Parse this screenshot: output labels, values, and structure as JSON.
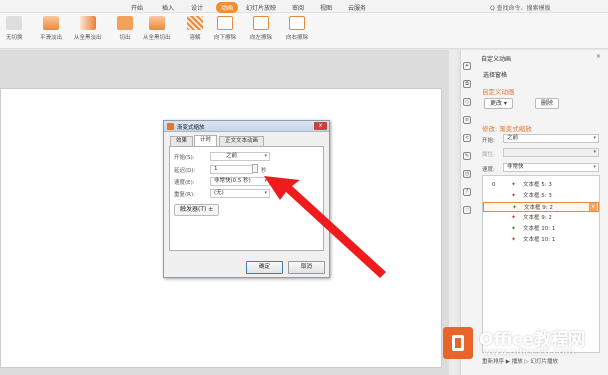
{
  "menubar": {
    "items": [
      {
        "label": "开始",
        "active": false
      },
      {
        "label": "插入",
        "active": false
      },
      {
        "label": "设计",
        "active": false
      },
      {
        "label": "动画",
        "active": true
      },
      {
        "label": "幻灯片放映",
        "active": false
      },
      {
        "label": "审阅",
        "active": false
      },
      {
        "label": "视图",
        "active": false
      },
      {
        "label": "云服务",
        "active": false
      }
    ],
    "search": "Q 查找命令、搜索模板"
  },
  "ribbon": {
    "tools": [
      "无切换",
      "平滑淡出",
      "从全黑淡出",
      "切出",
      "从全黑切出",
      "溶解",
      "向下擦除",
      "向左擦除",
      "向右擦除"
    ]
  },
  "accent": "#f08f32",
  "pane": {
    "title": "自定义动画",
    "close": "×",
    "select_pane": "选择窗格",
    "section_custom": "自定义动画",
    "change_button": "更改 ▾",
    "delete_button": "删除",
    "modify_title": "修改: 渐变式缩放",
    "start_label": "开始:",
    "start_value": "之前",
    "property_label": "属性:",
    "speed_label": "速度:",
    "speed_value": "非常快",
    "list": [
      {
        "num": "0",
        "star": "✦",
        "text": "文本框 5: 3",
        "selected": false
      },
      {
        "num": "",
        "star": "✦",
        "text": "文本框 5: 3",
        "selected": false
      },
      {
        "num": "",
        "star": "✦",
        "text": "文本框 9: 2",
        "selected": true
      },
      {
        "num": "",
        "star": "✦",
        "text": "文本框 9: 2",
        "selected": false
      },
      {
        "num": "",
        "star": "✦",
        "text": "文本框 10: 1",
        "selected": false
      },
      {
        "num": "",
        "star": "✦",
        "text": "文本框 10: 1",
        "selected": false
      }
    ],
    "bottom": "重新排序   ▶ 播放   ▷ 幻灯片播放"
  },
  "dialog": {
    "title": "渐变式缩放",
    "close": "x",
    "tabs": [
      "效果",
      "计时",
      "正文文本动画"
    ],
    "active_tab": 1,
    "start_label": "开始(S):",
    "start_value": "之前",
    "delay_label": "延迟(D):",
    "delay_value": "1",
    "delay_unit": "秒",
    "speed_label": "速度(E):",
    "speed_value": "非常快(0.5 秒)",
    "repeat_label": "重复(R):",
    "repeat_value": "(无)",
    "trigger_button": "触发器(T) ±",
    "ok_button": "确定",
    "cancel_button": "取消"
  },
  "watermark": {
    "line1": "Office教程网",
    "line2": "www.office26.com"
  }
}
